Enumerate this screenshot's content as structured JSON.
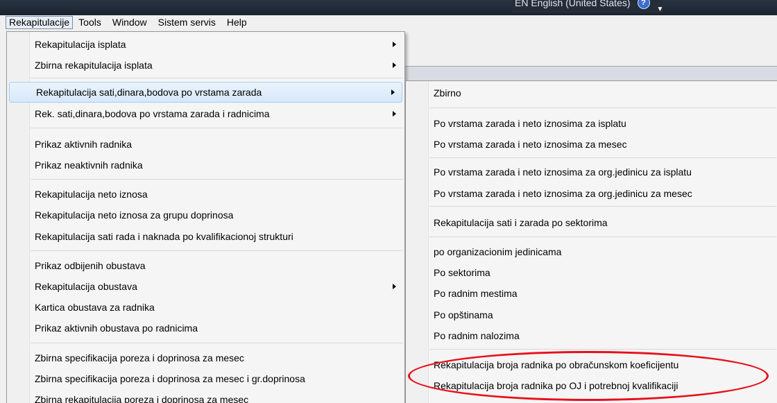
{
  "system": {
    "language_text": "EN English (United States)",
    "help_glyph": "?"
  },
  "menubar": {
    "items": [
      "Rekapitulacije",
      "Tools",
      "Window",
      "Sistem servis",
      "Help"
    ]
  },
  "main_menu": {
    "items": [
      "Rekapitulacija isplata",
      "Zbirna rekapitulacija isplata",
      "Rekapitulacija sati,dinara,bodova po vrstama zarada",
      "Rek. sati,dinara,bodova po vrstama zarada i radnicima",
      "Prikaz aktivnih radnika",
      "Prikaz neaktivnih radnika",
      "Rekapitulacija neto iznosa",
      "Rekapitulacija neto iznosa za grupu doprinosa",
      "Rekapitulacija sati rada i naknada po kvalifikacionoj strukturi",
      "Prikaz odbijenih obustava",
      "Rekapitulacija obustava",
      "Kartica obustava za radnika",
      "Prikaz aktivnih obustava po radnicima",
      "Zbirna specifikacija poreza i doprinosa za mesec",
      "Zbirna specifikacija poreza i doprinosa za mesec i gr.doprinosa",
      "Zbirna rekapitulacija poreza i doprinosa za mesec"
    ]
  },
  "sub_menu": {
    "items": [
      "Zbirno",
      "Po vrstama zarada i neto iznosima za isplatu",
      "Po vrstama zarada i neto iznosima za mesec",
      "Po vrstama zarada i neto iznosima za org.jedinicu za isplatu",
      "Po vrstama zarada i neto iznosima za org.jedinicu za mesec",
      "Rekapitulacija sati i zarada po sektorima",
      "po organizacionim jedinicama",
      "Po sektorima",
      "Po radnim mestima",
      "Po opštinama",
      "Po radnim nalozima",
      "Rekapitulacija broja radnika po obračunskom koeficijentu",
      "Rekapitulacija broja radnika po OJ i potrebnoj kvalifikaciji"
    ]
  },
  "colors": {
    "highlight": "#d6e8fa",
    "annotation": "#e8101a"
  }
}
